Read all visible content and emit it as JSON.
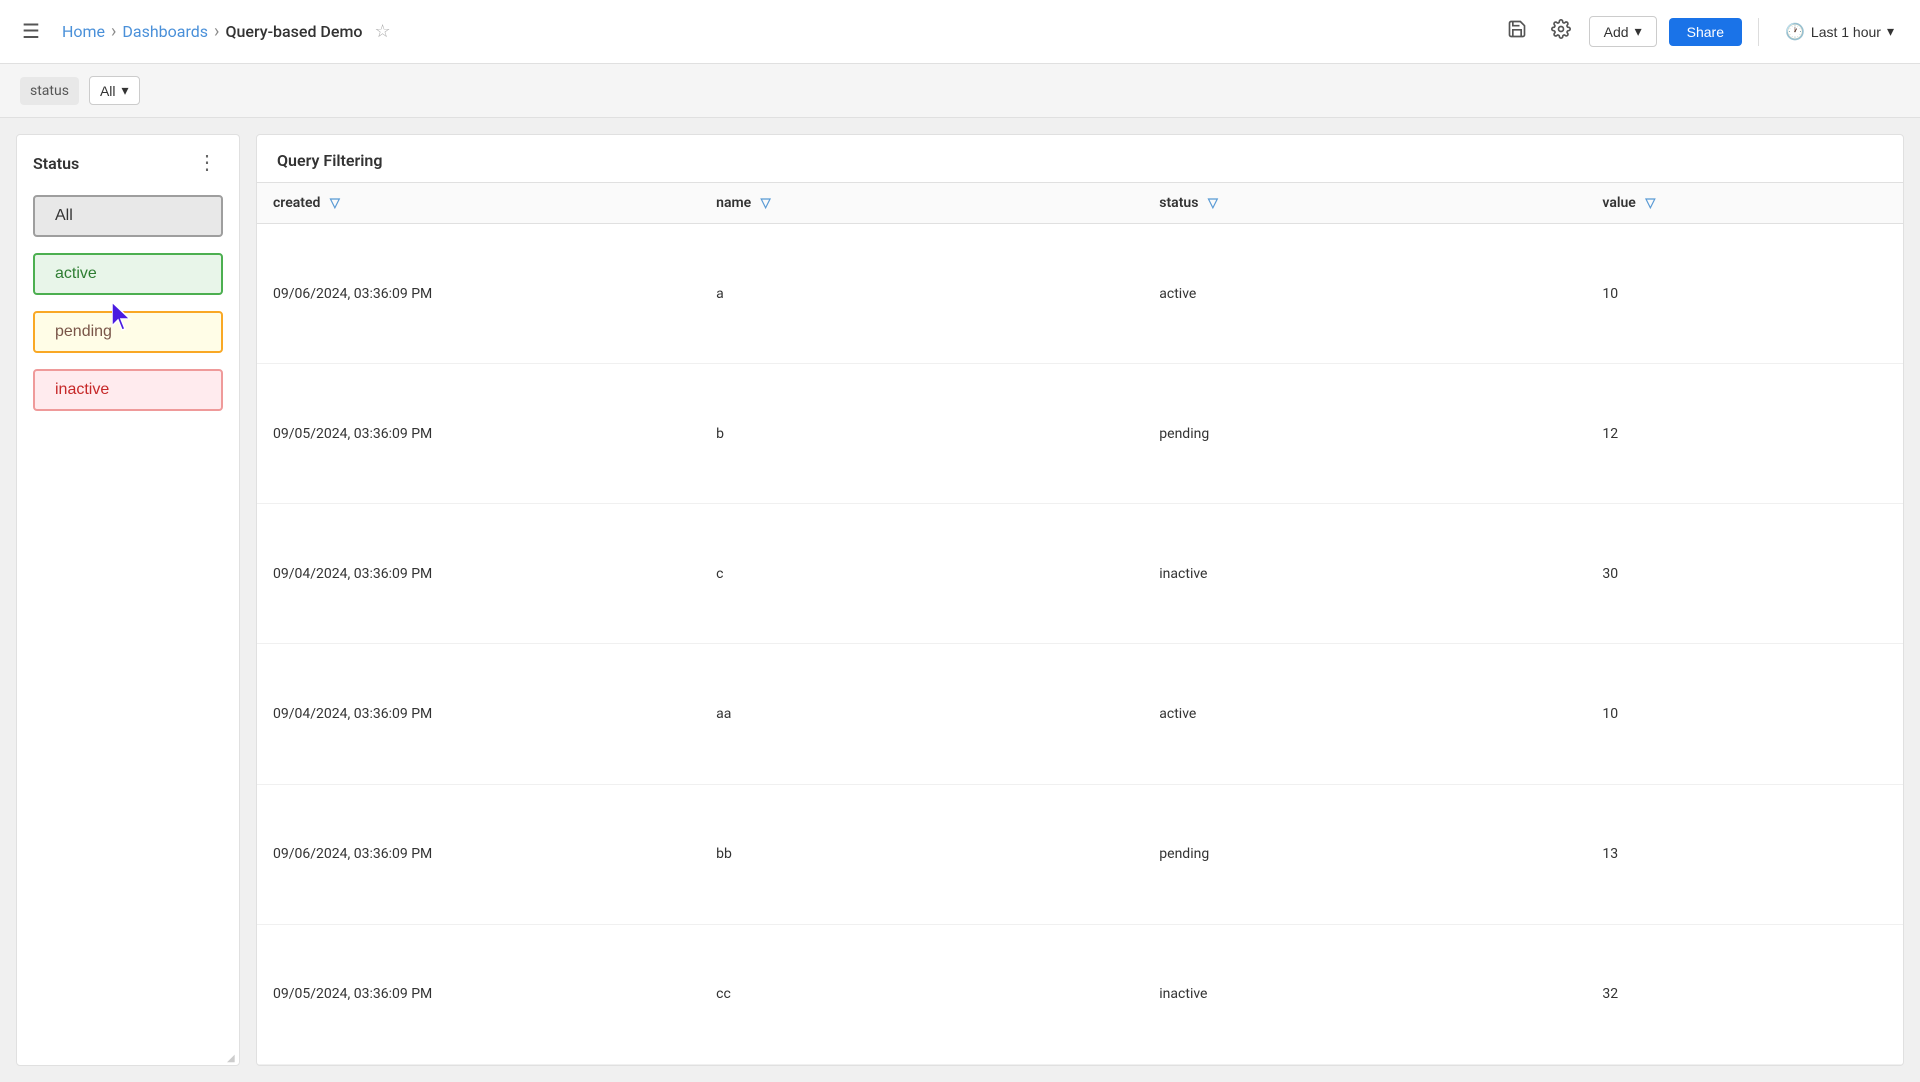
{
  "topbar": {
    "menu_icon": "☰",
    "breadcrumb": {
      "home": "Home",
      "dashboards": "Dashboards",
      "current": "Query-based Demo"
    },
    "star_icon": "☆",
    "save_icon": "💾",
    "settings_icon": "⚙",
    "add_label": "Add",
    "share_label": "Share",
    "time_range_label": "Last 1 hour",
    "chevron_down": "▾",
    "clock_icon": "🕐"
  },
  "filterbar": {
    "filter_label": "status",
    "filter_value": "All",
    "chevron_down": "▾"
  },
  "status_panel": {
    "title": "Status",
    "menu_icon": "⋮",
    "buttons": {
      "all": "All",
      "active": "active",
      "pending": "pending",
      "inactive": "inactive"
    }
  },
  "query_panel": {
    "title": "Query Filtering",
    "columns": [
      {
        "key": "created",
        "label": "created"
      },
      {
        "key": "name",
        "label": "name"
      },
      {
        "key": "status",
        "label": "status"
      },
      {
        "key": "value",
        "label": "value"
      }
    ],
    "rows": [
      {
        "created": "09/06/2024, 03:36:09 PM",
        "name": "a",
        "status": "active",
        "value": "10"
      },
      {
        "created": "09/05/2024, 03:36:09 PM",
        "name": "b",
        "status": "pending",
        "value": "12"
      },
      {
        "created": "09/04/2024, 03:36:09 PM",
        "name": "c",
        "status": "inactive",
        "value": "30"
      },
      {
        "created": "09/04/2024, 03:36:09 PM",
        "name": "aa",
        "status": "active",
        "value": "10"
      },
      {
        "created": "09/06/2024, 03:36:09 PM",
        "name": "bb",
        "status": "pending",
        "value": "13"
      },
      {
        "created": "09/05/2024, 03:36:09 PM",
        "name": "cc",
        "status": "inactive",
        "value": "32"
      }
    ]
  }
}
